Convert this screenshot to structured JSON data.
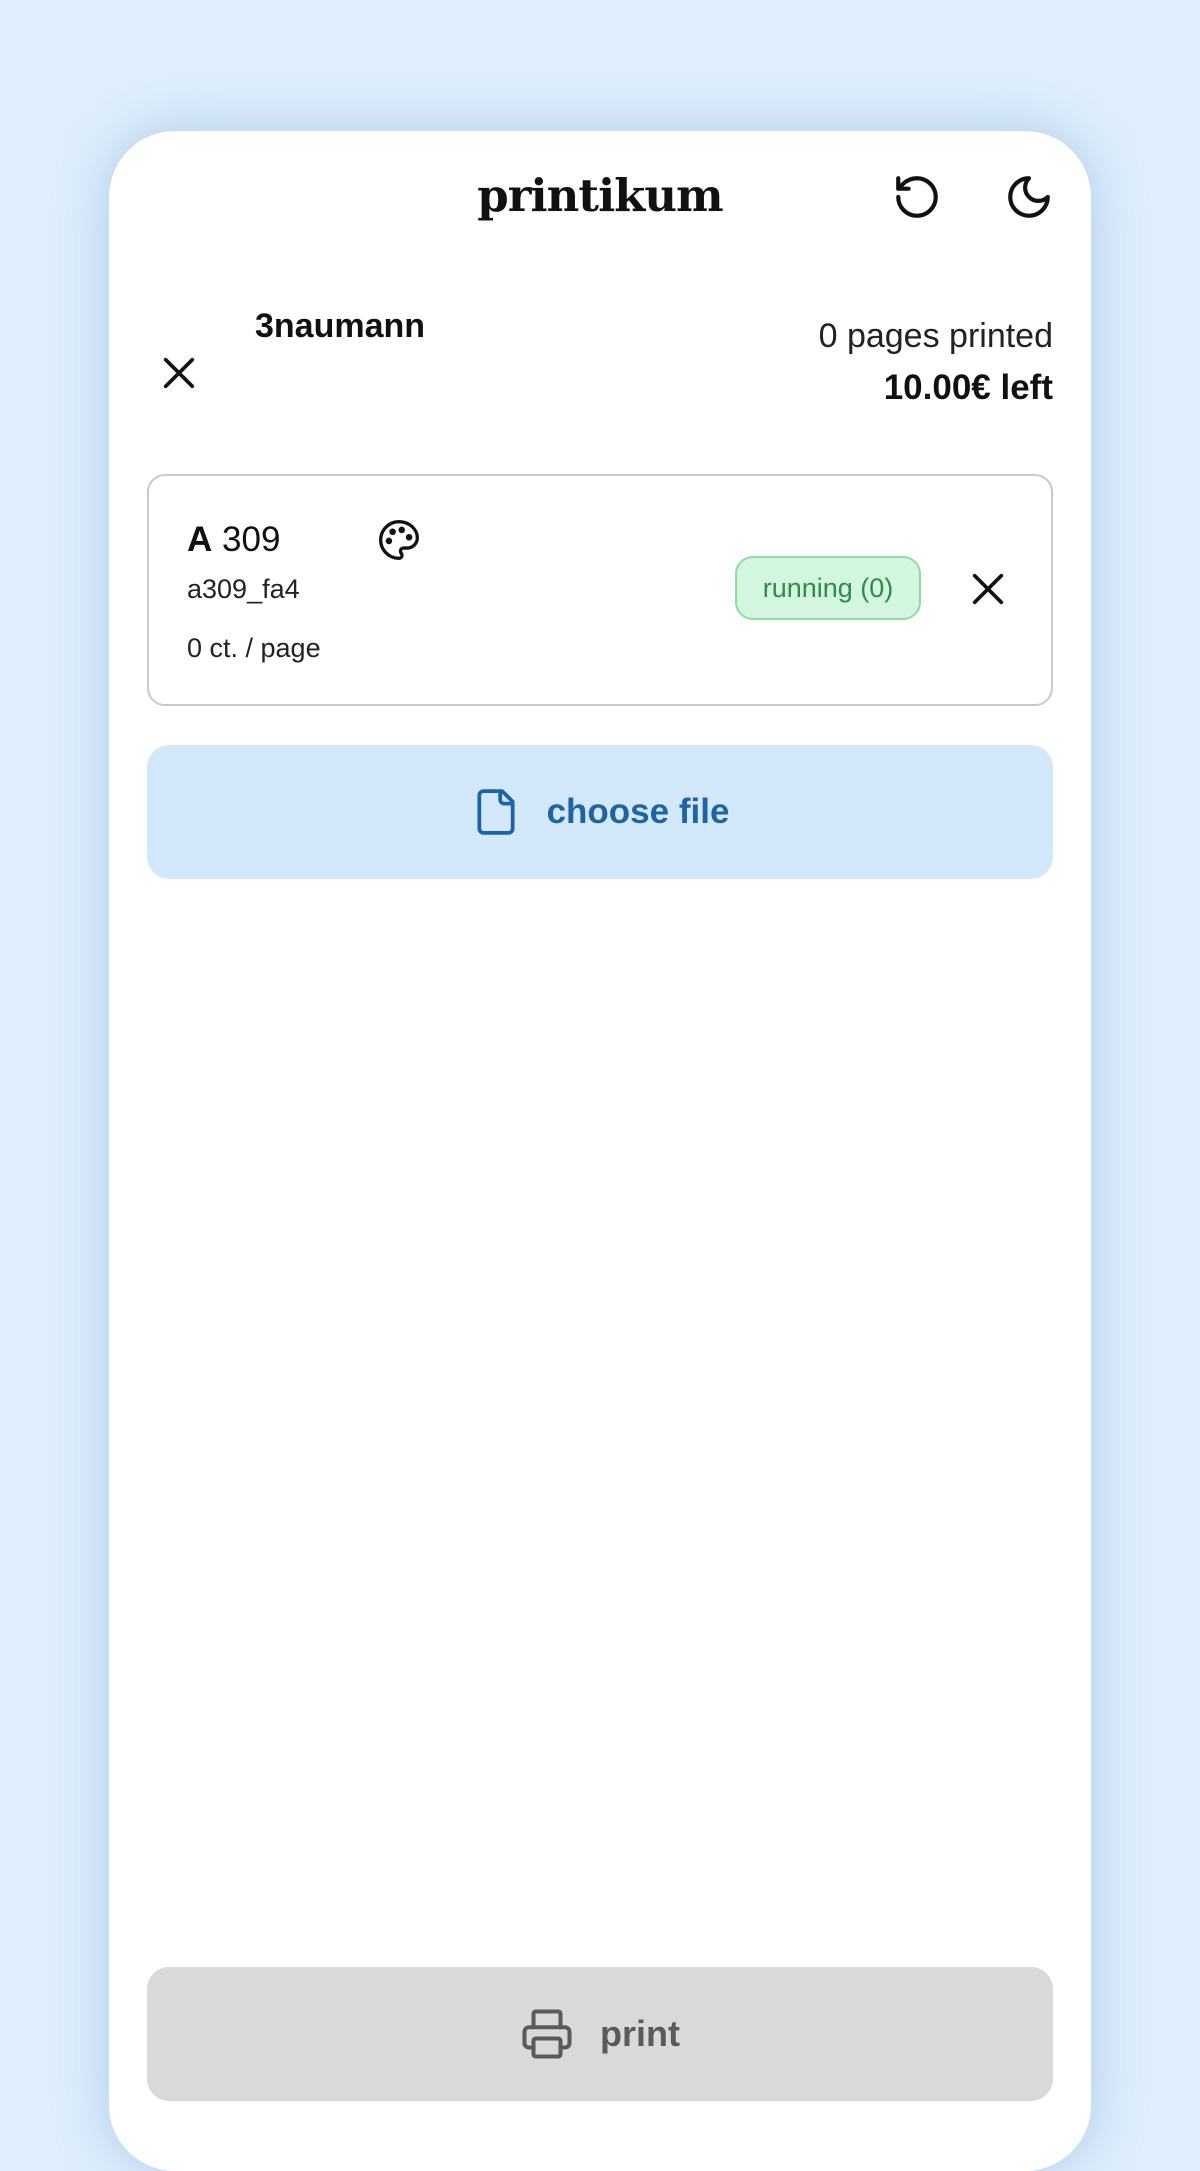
{
  "header": {
    "title": "printikum",
    "reset_icon": "rotate-ccw-icon",
    "theme_icon": "moon-icon"
  },
  "user": {
    "username": "3naumann",
    "pages_printed": "0 pages printed",
    "credit_left": "10.00€ left",
    "logout_icon": "close-icon"
  },
  "printer": {
    "building": "A",
    "room": "309",
    "id": "a309_fa4",
    "price": "0 ct. / page",
    "color_icon": "palette-icon",
    "status": "running (0)",
    "remove_icon": "close-icon"
  },
  "actions": {
    "choose_file_label": "choose file",
    "choose_file_icon": "file-icon",
    "print_label": "print",
    "print_icon": "printer-icon"
  },
  "colors": {
    "background": "#deeefd",
    "card": "#ffffff",
    "choose_file_bg": "#d4e8fb",
    "choose_file_text": "#1d64a6",
    "status_bg": "#d3f6de",
    "status_border": "#8fdba8",
    "status_text": "#2e8b4f",
    "print_disabled_bg": "#d9d9d9",
    "print_disabled_text": "#5a5a5a"
  }
}
